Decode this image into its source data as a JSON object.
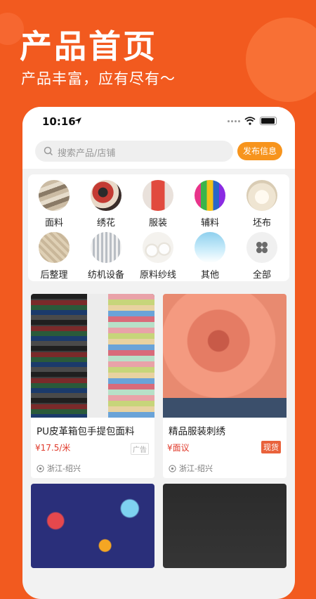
{
  "promo": {
    "title": "产品首页",
    "subtitle": "产品丰富，应有尽有～"
  },
  "status_bar": {
    "time": "10:16"
  },
  "search": {
    "placeholder": "搜索产品/店铺",
    "publish_label": "发布信息"
  },
  "categories": [
    {
      "label": "面料",
      "icon": "fabric-rolls-image"
    },
    {
      "label": "绣花",
      "icon": "embroidery-image"
    },
    {
      "label": "服装",
      "icon": "clothing-image"
    },
    {
      "label": "辅料",
      "icon": "accessories-image"
    },
    {
      "label": "坯布",
      "icon": "greige-cloth-image"
    },
    {
      "label": "后整理",
      "icon": "finishing-image"
    },
    {
      "label": "纺机设备",
      "icon": "textile-machinery-image"
    },
    {
      "label": "原料纱线",
      "icon": "yarn-spools-image"
    },
    {
      "label": "其他",
      "icon": "other-image"
    },
    {
      "label": "全部",
      "icon": "all-grid-icon"
    }
  ],
  "products": [
    {
      "title": "PU皮革箱包手提包面料",
      "price": "¥17.5/米",
      "tag": "广告",
      "location": "浙江-绍兴"
    },
    {
      "title": "精品服装刺绣",
      "price": "¥面议",
      "tag": "现货",
      "location": "浙江-绍兴"
    }
  ],
  "colors": {
    "brand": "#f25a1f",
    "publish_button": "#f7941d",
    "price": "#e03a2b",
    "stock_tag": "#e9623b"
  }
}
